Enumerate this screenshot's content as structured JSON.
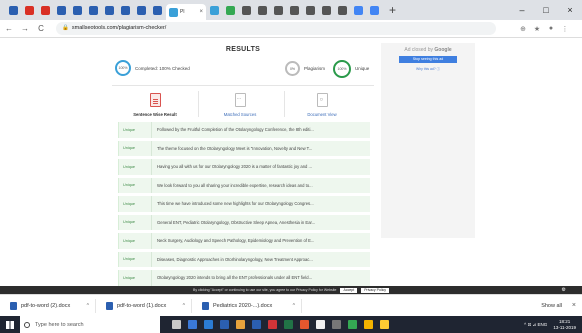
{
  "browser": {
    "tabs": [
      {
        "color": "#2b5fb0"
      },
      {
        "color": "#d93025"
      },
      {
        "color": "#d93025"
      },
      {
        "color": "#2b5fb0"
      },
      {
        "color": "#2b5fb0"
      },
      {
        "color": "#2b5fb0"
      },
      {
        "color": "#2b5fb0"
      },
      {
        "color": "#2b5fb0"
      },
      {
        "color": "#2b5fb0"
      },
      {
        "color": "#2b5fb0"
      },
      {
        "color": "#3aa0d8"
      },
      {
        "color": "#34a853"
      },
      {
        "color": "#555555"
      },
      {
        "color": "#555555"
      },
      {
        "color": "#555555"
      },
      {
        "color": "#555555"
      },
      {
        "color": "#555555"
      },
      {
        "color": "#555555"
      },
      {
        "color": "#555555"
      },
      {
        "color": "#4285f4"
      },
      {
        "color": "#4285f4"
      }
    ],
    "active_tab_title": "Pl",
    "active_tab_close": "×",
    "new_tab": "+",
    "window_controls": {
      "minimize": "–",
      "maximize": "□",
      "close": "×"
    },
    "back": "←",
    "forward": "→",
    "reload": "C",
    "lock": "🔒",
    "url": "smallseotools.com/plagiarism-checker/",
    "ext_icons": [
      "⊕",
      "★",
      "●",
      "⋮"
    ]
  },
  "results": {
    "title": "RESULTS",
    "completed_pct": "100%",
    "completed_label": "Completed: 100% Checked",
    "plagiarism_pct": "0%",
    "plagiarism_label": "Plagiarism",
    "unique_pct": "100%",
    "unique_label": "Unique"
  },
  "tools": {
    "sentence_wise": "Sentence Wise Result",
    "matched_sources": "Matched Sources",
    "document_view": "Document View"
  },
  "rows": [
    {
      "status": "Unique",
      "text": "Followed by the Fruitful Completion of the Otolaryngology Conference, the 8th editi..."
    },
    {
      "status": "Unique",
      "text": "The theme focused on the Otolaryngology Meet is \"Innovation, Novelty and New T..."
    },
    {
      "status": "Unique",
      "text": "Having you all with us for our Otolaryngology 2020 is a matter of fantastic joy and ..."
    },
    {
      "status": "Unique",
      "text": "We look forward to you all sharing your incredible expertise, research ideas and to..."
    },
    {
      "status": "Unique",
      "text": "This time we have introduced some new highlights for our Otolaryngology Congres..."
    },
    {
      "status": "Unique",
      "text": "General ENT, Pediatric Otolaryngology, Obstructive Sleep Apnea, Anesthesia in Ear..."
    },
    {
      "status": "Unique",
      "text": "Neck Surgery, Audiology and Speech Pathology, Epidemiology and Prevention of E..."
    },
    {
      "status": "Unique",
      "text": "Diseases, Diagnostic Approaches in Otorhinolaryngology, New Treatment Approac..."
    },
    {
      "status": "Unique",
      "text": "Otolaryngology 2020 intends to bring all the ENT professionals under all ENT field..."
    }
  ],
  "ad": {
    "closed_by": "Ad closed by ",
    "google": "Google",
    "stop": "Stop seeing this ad",
    "why": "Why this ad? ⓘ"
  },
  "cookie": {
    "text": "By clicking \"Accept\" or continuing to use our site, you agree to our Privacy Policy for Website",
    "accept": "Accept",
    "policy": "Privacy Policy",
    "gear": "⚙"
  },
  "downloads": {
    "items": [
      {
        "name": "pdf-to-word (2).docx",
        "chevron": "^"
      },
      {
        "name": "pdf-to-word (1).docx",
        "chevron": "^"
      },
      {
        "name": "Pediatrics 2020-...).docx",
        "chevron": "^"
      }
    ],
    "show_all": "Show all",
    "close": "×"
  },
  "taskbar": {
    "search_placeholder": "Type here to search",
    "apps": [
      {
        "color": "#c9c9c9"
      },
      {
        "color": "#3a79d8"
      },
      {
        "color": "#2b7cd3"
      },
      {
        "color": "#2b5fb0"
      },
      {
        "color": "#e8a33c"
      },
      {
        "color": "#2b5fb0"
      },
      {
        "color": "#d13438"
      },
      {
        "color": "#217346"
      },
      {
        "color": "#e4572e"
      },
      {
        "color": "#f0f0f0"
      },
      {
        "color": "#777777"
      },
      {
        "color": "#34a853"
      },
      {
        "color": "#f4b400"
      },
      {
        "color": "#ffcc33"
      }
    ],
    "tray_text": "^ ⊡ ⊿ ENG",
    "time": "18:21",
    "date": "13-11-2019"
  }
}
